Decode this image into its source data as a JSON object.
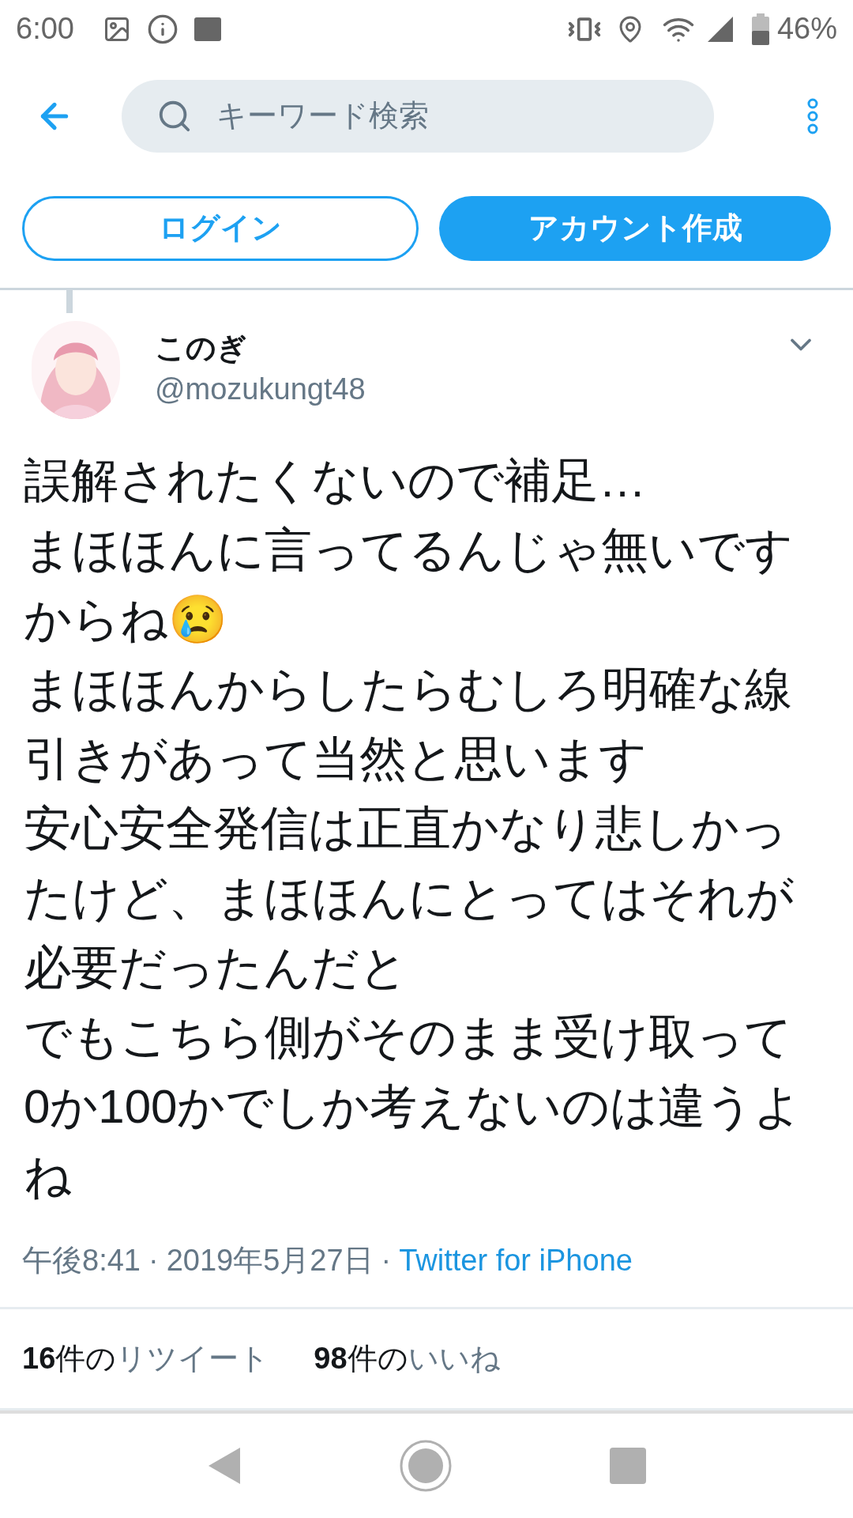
{
  "status_bar": {
    "time": "6:00",
    "battery": "46%"
  },
  "header": {
    "search": {
      "placeholder": "キーワード検索"
    }
  },
  "auth_buttons": [
    {
      "label": "ログイン",
      "kind": "outline"
    },
    {
      "label": "アカウント作成",
      "kind": "filled"
    }
  ],
  "tweet": {
    "name": "このぎ",
    "handle": "@mozukungt48",
    "paragraphs": [
      "誤解されたくないので補足…",
      "まほほんに言ってるんじゃ無いですからね😢",
      "まほほんからしたらむしろ明確な線引きがあって当然と思います",
      "安心安全発信は正直かなり悲しかったけど、まほほんにとってはそれが必要だったんだと",
      "でもこちら側がそのまま受け取って0か100かでしか考えないのは違うよね"
    ],
    "time": "午後8:41",
    "separators": [
      "·",
      "·"
    ],
    "date": "2019年5月27日",
    "source": "Twitter for iPhone",
    "stats": [
      {
        "count": "16",
        "unit": "件の",
        "label": "リツイート"
      },
      {
        "count": "98",
        "unit": "件の",
        "label": "いいね"
      }
    ]
  }
}
